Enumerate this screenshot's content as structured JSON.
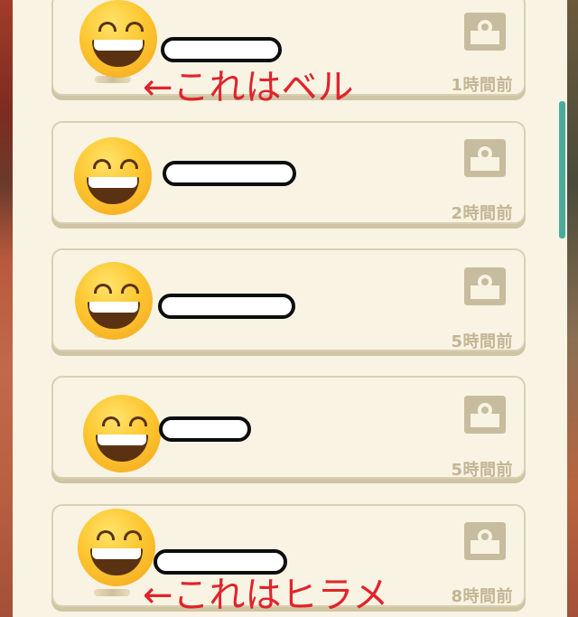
{
  "entries": [
    {
      "time": "1時間前",
      "icon": "bag-icon",
      "avatar": "grinning-face-emoji"
    },
    {
      "time": "2時間前",
      "icon": "bag-icon",
      "avatar": "grinning-face-emoji"
    },
    {
      "time": "5時間前",
      "icon": "bag-icon",
      "avatar": "grinning-face-emoji"
    },
    {
      "time": "5時間前",
      "icon": "bag-icon",
      "avatar": "grinning-face-emoji"
    },
    {
      "time": "8時間前",
      "icon": "bag-icon",
      "avatar": "grinning-face-emoji"
    }
  ],
  "annotations": {
    "bell": "←これはベル",
    "flounder": "←これはヒラメ"
  },
  "colors": {
    "panel_bg": "#f8f3e3",
    "card_border": "#d9cfb3",
    "time_text": "#c3b594",
    "annotation": "#e1232b",
    "scrollbar": "#4bab9a"
  }
}
